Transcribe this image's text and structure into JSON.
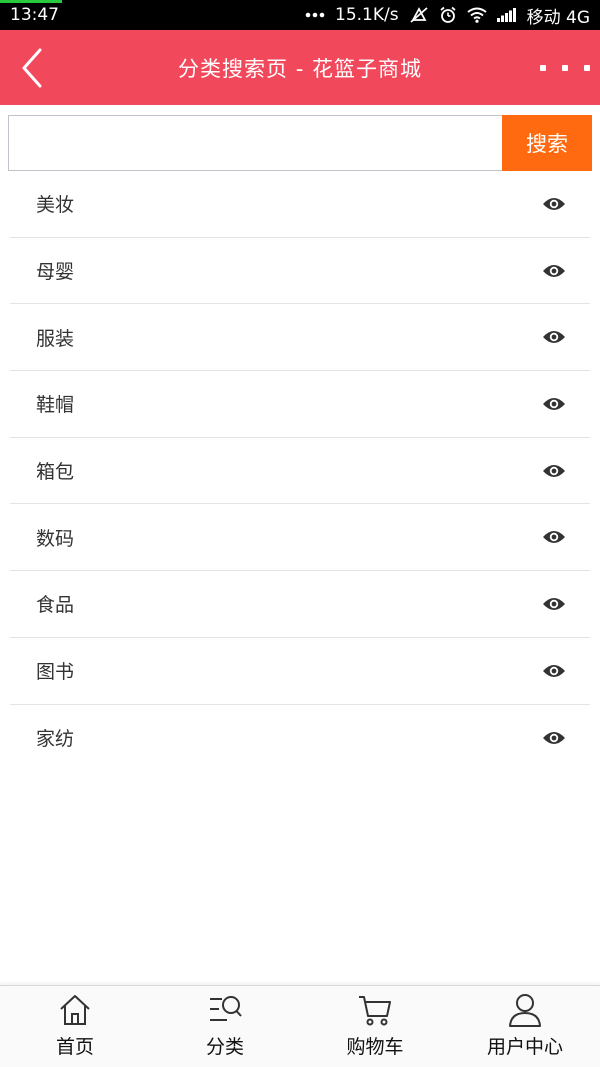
{
  "status_bar": {
    "time": "13:47",
    "speed": "15.1K/s",
    "carrier": "移动 4G"
  },
  "header": {
    "title": "分类搜索页 - 花篮子商城",
    "back_icon": "chevron-left-icon",
    "more_icon": "more-dots-icon"
  },
  "search": {
    "value": "",
    "placeholder": "",
    "button_label": "搜索"
  },
  "categories": [
    {
      "label": "美妆",
      "icon": "eye-icon"
    },
    {
      "label": "母婴",
      "icon": "eye-icon"
    },
    {
      "label": "服装",
      "icon": "eye-icon"
    },
    {
      "label": "鞋帽",
      "icon": "eye-icon"
    },
    {
      "label": "箱包",
      "icon": "eye-icon"
    },
    {
      "label": "数码",
      "icon": "eye-icon"
    },
    {
      "label": "食品",
      "icon": "eye-icon"
    },
    {
      "label": "图书",
      "icon": "eye-icon"
    },
    {
      "label": "家纺",
      "icon": "eye-icon"
    }
  ],
  "bottom_nav": [
    {
      "label": "首页",
      "icon": "home-icon"
    },
    {
      "label": "分类",
      "icon": "category-search-icon"
    },
    {
      "label": "购物车",
      "icon": "cart-icon"
    },
    {
      "label": "用户中心",
      "icon": "user-icon"
    }
  ],
  "colors": {
    "header_bg": "#f2485b",
    "search_button_bg": "#ff6a10"
  }
}
